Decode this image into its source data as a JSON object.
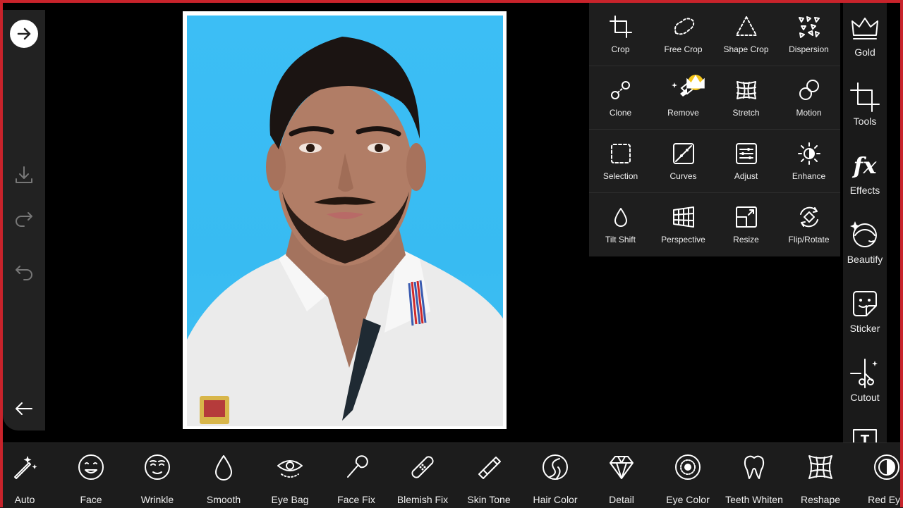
{
  "tools": [
    {
      "label": "Crop",
      "icon": "crop-icon"
    },
    {
      "label": "Free Crop",
      "icon": "free-crop-icon"
    },
    {
      "label": "Shape Crop",
      "icon": "shape-crop-icon"
    },
    {
      "label": "Dispersion",
      "icon": "dispersion-icon"
    },
    {
      "label": "Clone",
      "icon": "clone-icon"
    },
    {
      "label": "Remove",
      "icon": "remove-icon",
      "premium": true
    },
    {
      "label": "Stretch",
      "icon": "stretch-icon"
    },
    {
      "label": "Motion",
      "icon": "motion-icon"
    },
    {
      "label": "Selection",
      "icon": "selection-icon"
    },
    {
      "label": "Curves",
      "icon": "curves-icon"
    },
    {
      "label": "Adjust",
      "icon": "adjust-icon"
    },
    {
      "label": "Enhance",
      "icon": "enhance-icon"
    },
    {
      "label": "Tilt Shift",
      "icon": "tilt-shift-icon"
    },
    {
      "label": "Perspective",
      "icon": "perspective-icon"
    },
    {
      "label": "Resize",
      "icon": "resize-icon"
    },
    {
      "label": "Flip/Rotate",
      "icon": "flip-rotate-icon"
    }
  ],
  "rail": [
    {
      "label": "Gold",
      "icon": "crown-icon"
    },
    {
      "label": "Tools",
      "icon": "crop-icon"
    },
    {
      "label": "Effects",
      "icon": "fx-icon"
    },
    {
      "label": "Beautify",
      "icon": "face-sparkle-icon"
    },
    {
      "label": "Sticker",
      "icon": "sticker-icon"
    },
    {
      "label": "Cutout",
      "icon": "cutout-icon"
    },
    {
      "label": "",
      "icon": "text-icon"
    }
  ],
  "bottom": [
    {
      "label": "Auto",
      "icon": "magic-wand-icon"
    },
    {
      "label": "Face",
      "icon": "face-icon"
    },
    {
      "label": "Wrinkle",
      "icon": "wrinkle-icon"
    },
    {
      "label": "Smooth",
      "icon": "drop-icon"
    },
    {
      "label": "Eye Bag",
      "icon": "eye-icon"
    },
    {
      "label": "Face Fix",
      "icon": "brush-icon"
    },
    {
      "label": "Blemish Fix",
      "icon": "bandage-icon"
    },
    {
      "label": "Skin Tone",
      "icon": "tube-icon"
    },
    {
      "label": "Hair Color",
      "icon": "hair-icon"
    },
    {
      "label": "Detail",
      "icon": "diamond-icon"
    },
    {
      "label": "Eye Color",
      "icon": "iris-icon"
    },
    {
      "label": "Teeth Whiten",
      "icon": "tooth-icon"
    },
    {
      "label": "Reshape",
      "icon": "grid-warp-icon"
    },
    {
      "label": "Red Eye",
      "icon": "red-eye-icon"
    }
  ],
  "colors": {
    "accent": "#c8232b",
    "panel": "#1e1e1e",
    "sky": "#3cbef5",
    "badge": "#f5c518"
  }
}
